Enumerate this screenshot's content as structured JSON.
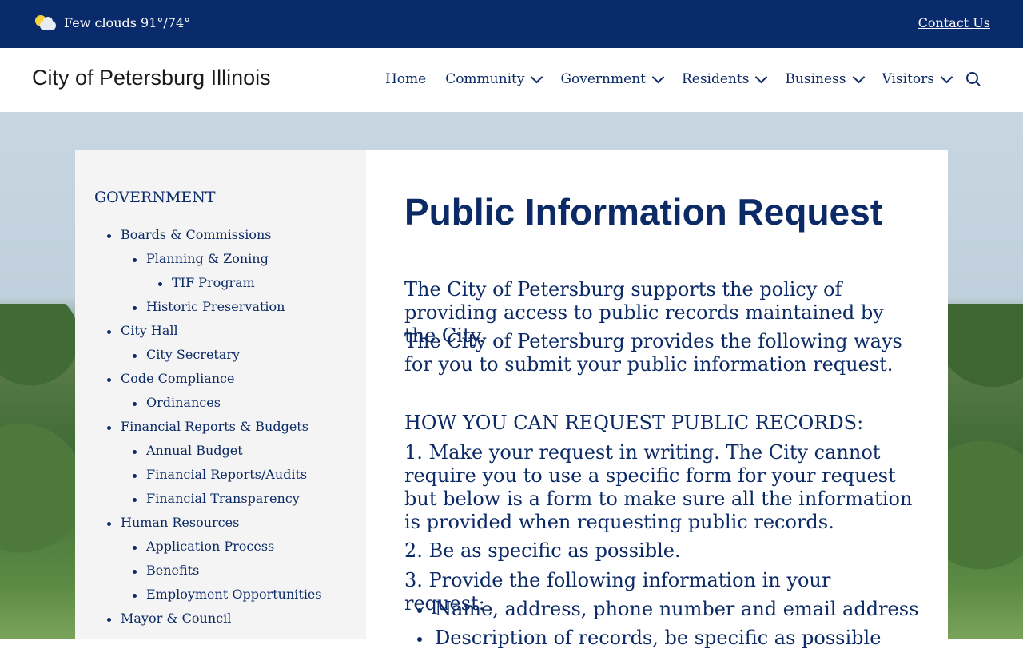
{
  "topbar": {
    "weather_text": "Few clouds 91°/74°",
    "contact_label": "Contact Us"
  },
  "header": {
    "site_title": "City of Petersburg Illinois",
    "nav": [
      {
        "label": "Home",
        "has_dropdown": false
      },
      {
        "label": "Community",
        "has_dropdown": true
      },
      {
        "label": "Government",
        "has_dropdown": true
      },
      {
        "label": "Residents",
        "has_dropdown": true
      },
      {
        "label": "Business",
        "has_dropdown": true
      },
      {
        "label": "Visitors",
        "has_dropdown": true
      }
    ]
  },
  "sidebar": {
    "title": "GOVERNMENT",
    "items": [
      {
        "label": "Boards & Commissions",
        "level": 1
      },
      {
        "label": "Planning & Zoning",
        "level": 2
      },
      {
        "label": "TIF Program",
        "level": 3
      },
      {
        "label": "Historic Preservation",
        "level": 2
      },
      {
        "label": "City Hall",
        "level": 1
      },
      {
        "label": "City Secretary",
        "level": 2
      },
      {
        "label": "Code Compliance",
        "level": 1
      },
      {
        "label": "Ordinances",
        "level": 2
      },
      {
        "label": "Financial Reports & Budgets",
        "level": 1
      },
      {
        "label": "Annual Budget",
        "level": 2
      },
      {
        "label": "Financial Reports/Audits",
        "level": 2
      },
      {
        "label": "Financial Transparency",
        "level": 2
      },
      {
        "label": "Human Resources",
        "level": 1
      },
      {
        "label": "Application Process",
        "level": 2
      },
      {
        "label": "Benefits",
        "level": 2
      },
      {
        "label": "Employment Opportunities",
        "level": 2
      },
      {
        "label": "Mayor & Council",
        "level": 1
      }
    ]
  },
  "main": {
    "title": "Public Information Request",
    "intro_1": "The City of Petersburg supports the policy of providing access to public records maintained by the City.",
    "intro_2": "The City of Petersburg provides the following ways for you to submit your public information request.",
    "how_heading": "HOW YOU CAN REQUEST PUBLIC RECORDS:",
    "step_1": "1. Make your request in writing. The City cannot require you to use a specific form for your request but below is a form to make sure all the information is provided when requesting public records.",
    "step_2": "2. Be as specific as possible.",
    "step_3": "3. Provide the following information in your request:",
    "bullets": [
      "Name, address, phone number and email address",
      "Description of records, be specific as possible"
    ]
  }
}
